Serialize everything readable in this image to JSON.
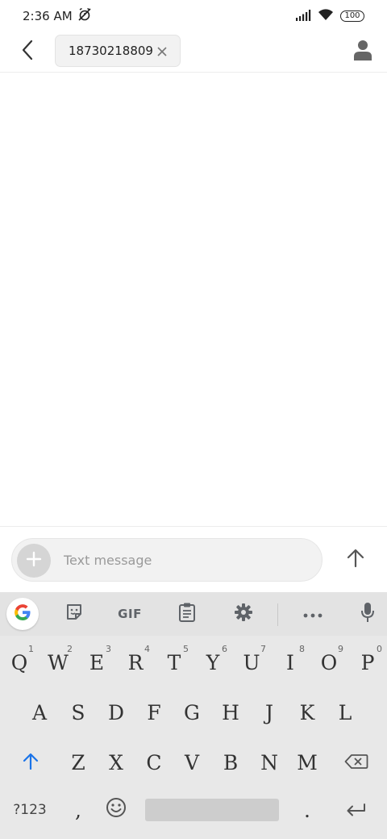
{
  "status_bar": {
    "time": "2:36 AM",
    "battery": "100"
  },
  "header": {
    "recipient": "18730218809"
  },
  "compose": {
    "placeholder": "Text message"
  },
  "keyboard": {
    "toolbar": {
      "gif_label": "GIF"
    },
    "row1": [
      {
        "letter": "Q",
        "hint": "1"
      },
      {
        "letter": "W",
        "hint": "2"
      },
      {
        "letter": "E",
        "hint": "3"
      },
      {
        "letter": "R",
        "hint": "4"
      },
      {
        "letter": "T",
        "hint": "5"
      },
      {
        "letter": "Y",
        "hint": "6"
      },
      {
        "letter": "U",
        "hint": "7"
      },
      {
        "letter": "I",
        "hint": "8"
      },
      {
        "letter": "O",
        "hint": "9"
      },
      {
        "letter": "P",
        "hint": "0"
      }
    ],
    "row2": [
      "A",
      "S",
      "D",
      "F",
      "G",
      "H",
      "J",
      "K",
      "L"
    ],
    "row3": [
      "Z",
      "X",
      "C",
      "V",
      "B",
      "N",
      "M"
    ],
    "bottom": {
      "symbols": "?123",
      "comma": ",",
      "period": "."
    }
  },
  "icons": {
    "back": "back-arrow-icon",
    "close": "close-icon",
    "contact": "person-icon",
    "add": "plus-icon",
    "send": "send-arrow-icon",
    "google": "google-g-icon",
    "sticker": "sticker-icon",
    "clipboard": "clipboard-icon",
    "settings": "gear-icon",
    "more": "more-dots-icon",
    "mic": "mic-icon",
    "shift": "shift-arrow-icon",
    "backspace": "backspace-icon",
    "emoji": "emoji-icon",
    "enter": "enter-icon"
  },
  "colors": {
    "accent_blue": "#1a73e8",
    "keyboard_bg": "#e8e8e8"
  }
}
